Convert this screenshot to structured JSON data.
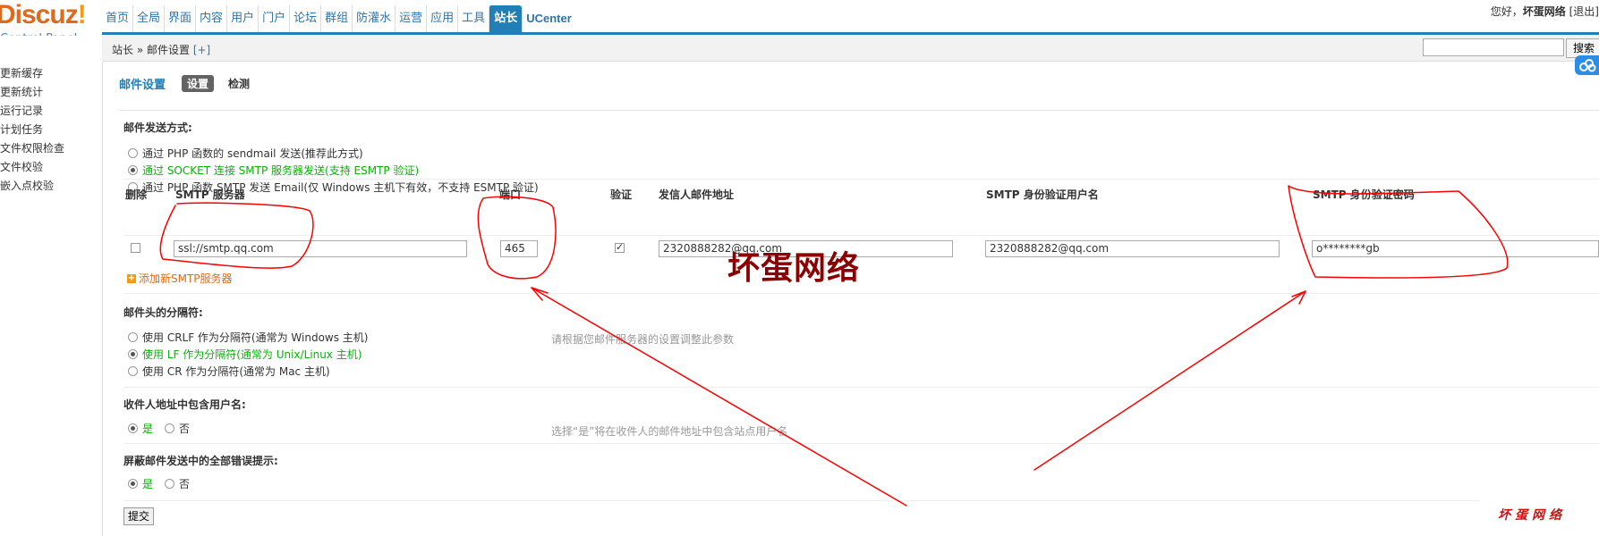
{
  "header": {
    "logo_text": "Discuz",
    "logo_mark": "!",
    "logo_sub": "Control Panel",
    "nav": [
      "首页",
      "全局",
      "界面",
      "内容",
      "用户",
      "门户",
      "论坛",
      "群组",
      "防灌水",
      "运营",
      "应用",
      "工具",
      "站长",
      "UCenter"
    ],
    "nav_active_index": 12,
    "greeting": "您好，",
    "username": "坏蛋网络",
    "logout": "[退出]"
  },
  "sidebar": {
    "items": [
      "更新缓存",
      "更新统计",
      "运行记录",
      "计划任务",
      "文件权限检查",
      "文件校验",
      "嵌入点校验"
    ]
  },
  "breadcrumb": {
    "text": "站长 » 邮件设置",
    "add": "[+]"
  },
  "search": {
    "button": "搜索",
    "value": ""
  },
  "tabs": {
    "title": "邮件设置",
    "items": [
      "设置",
      "检测"
    ],
    "current_index": 0
  },
  "mail_method": {
    "title": "邮件发送方式:",
    "options": [
      "通过 PHP 函数的 sendmail 发送(推荐此方式)",
      "通过 SOCKET 连接 SMTP 服务器发送(支持 ESMTP 验证)",
      "通过 PHP 函数 SMTP 发送 Email(仅 Windows 主机下有效，不支持 ESMTP 验证)"
    ],
    "selected_index": 1
  },
  "smtp_table": {
    "headers": [
      "删除",
      "SMTP 服务器",
      "端口",
      "验证",
      "发信人邮件地址",
      "SMTP 身份验证用户名",
      "SMTP 身份验证密码"
    ],
    "rows": [
      {
        "delete": false,
        "server": "ssl://smtp.qq.com",
        "port": "465",
        "auth": true,
        "from": "2320888282@qq.com",
        "username": "2320888282@qq.com",
        "password": "o********gb"
      }
    ],
    "add_label": "添加新SMTP服务器"
  },
  "header_separator": {
    "title": "邮件头的分隔符:",
    "options": [
      "使用 CRLF 作为分隔符(通常为 Windows 主机)",
      "使用 LF 作为分隔符(通常为 Unix/Linux 主机)",
      "使用 CR 作为分隔符(通常为 Mac 主机)"
    ],
    "selected_index": 1,
    "tip": "请根据您邮件服务器的设置调整此参数"
  },
  "include_username": {
    "title": "收件人地址中包含用户名:",
    "yes": "是",
    "no": "否",
    "value": "是",
    "tip": "选择“是”将在收件人的邮件地址中包含站点用户名"
  },
  "silent_errors": {
    "title": "屏蔽邮件发送中的全部错误提示:",
    "yes": "是",
    "no": "否",
    "value": "是"
  },
  "submit_label": "提交",
  "annotations": {
    "watermark": "坏蛋网络",
    "watermark_small": "坏蛋网络",
    "stroke_color": "#ff0000"
  }
}
